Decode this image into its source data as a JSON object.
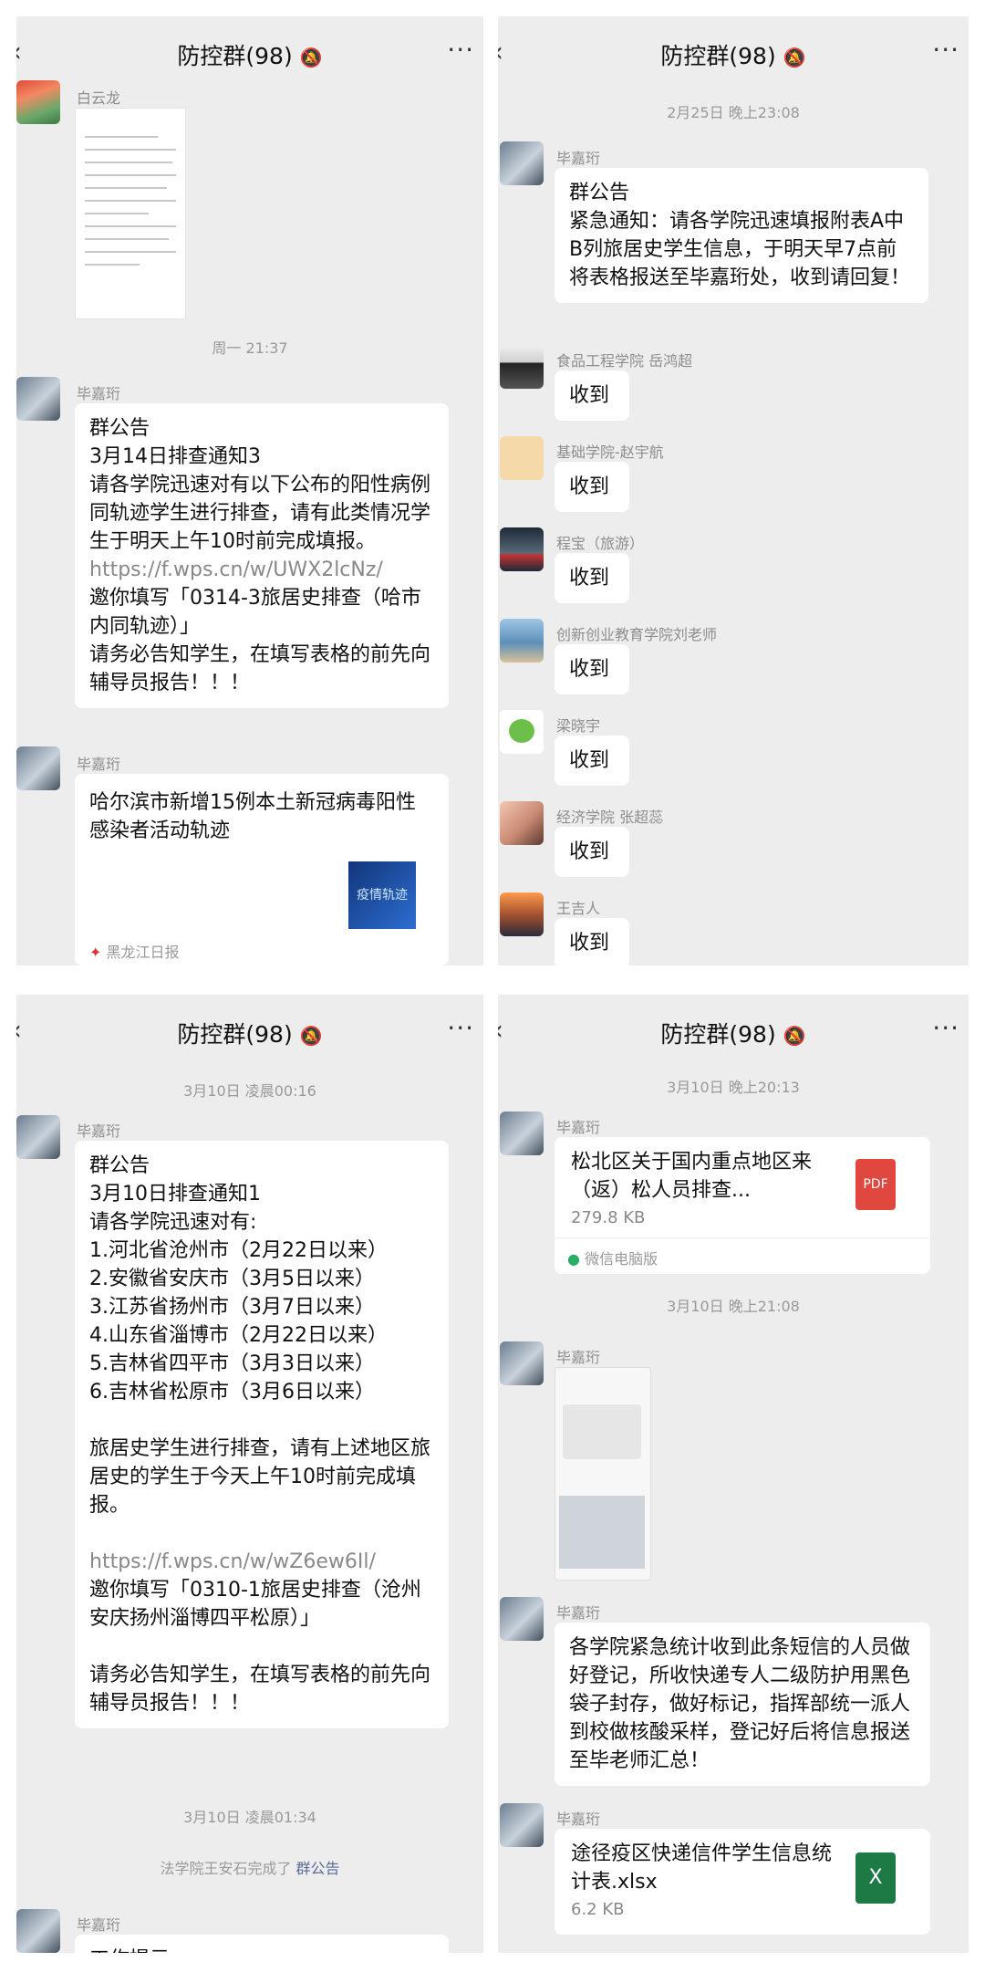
{
  "group_title": "防控群(98)",
  "panel1": {
    "sender1": "白云龙",
    "time1": "周一 21:37",
    "sender2": "毕嘉珩",
    "msg2": "群公告\n3月14日排查通知3\n请各学院迅速对有以下公布的阳性病例同轨迹学生进行排查，请有此类情况学生于明天上午10时前完成填报。",
    "link2": "https://f.wps.cn/w/UWX2lcNz/",
    "msg2b": "邀你填写「0314-3旅居史排查（哈市内同轨迹）」\n请务必告知学生，在填写表格的前先向辅导员报告！！！",
    "sender3": "毕嘉珩",
    "msg3": "哈尔滨市新增15例本土新冠病毒阳性感染者活动轨迹",
    "thumb3": "疫情轨迹",
    "source3": "黑龙江日报"
  },
  "panel2": {
    "time1": "2月25日 晚上23:08",
    "sender1": "毕嘉珩",
    "msg1": "群公告\n紧急通知：请各学院迅速填报附表A中B列旅居史学生信息，于明天早7点前将表格报送至毕嘉珩处，收到请回复！",
    "replies": [
      {
        "sender": "食品工程学院 岳鸿超",
        "text": "收到"
      },
      {
        "sender": "基础学院-赵宇航",
        "text": "收到"
      },
      {
        "sender": "程宝（旅游）",
        "text": "收到"
      },
      {
        "sender": "创新创业教育学院刘老师",
        "text": "收到"
      },
      {
        "sender": "梁晓宇",
        "text": "收到"
      },
      {
        "sender": "经济学院 张超蕊",
        "text": "收到"
      },
      {
        "sender": "王吉人",
        "text": "收到"
      }
    ]
  },
  "panel3": {
    "time1": "3月10日 凌晨00:16",
    "sender1": "毕嘉珩",
    "msg1": "群公告\n3月10日排查通知1\n请各学院迅速对有:\n1.河北省沧州市（2月22日以来）\n2.安徽省安庆市（3月5日以来）\n3.江苏省扬州市（3月7日以来）\n4.山东省淄博市（2月22日以来）\n5.吉林省四平市（3月3日以来）\n6.吉林省松原市（3月6日以来）\n\n旅居史学生进行排查，请有上述地区旅居史的学生于今天上午10时前完成填报。\n\n",
    "link1": "https://f.wps.cn/w/wZ6ew6Il/",
    "msg1b": "邀你填写「0310-1旅居史排查（沧州安庆扬州淄博四平松原）」\n\n请务必告知学生，在填写表格的前先向辅导员报告！！！",
    "time2": "3月10日 凌晨01:34",
    "notice_prefix": "法学院王安石完成了",
    "notice_link": "群公告",
    "sender2": "毕嘉珩",
    "msg2": "工作提示"
  },
  "panel4": {
    "time1": "3月10日 晚上20:13",
    "sender1": "毕嘉珩",
    "file1_name": "松北区关于国内重点地区来（返）松人员排查...",
    "file1_size": "279.8 KB",
    "file1_icon": "PDF",
    "file1_source": "微信电脑版",
    "time2": "3月10日 晚上21:08",
    "sender2": "毕嘉珩",
    "sender3": "毕嘉珩",
    "msg3": "各学院紧急统计收到此条短信的人员做好登记，所收快递专人二级防护用黑色袋子封存，做好标记，指挥部统一派人到校做核酸采样，登记好后将信息报送至毕老师汇总！",
    "sender4": "毕嘉珩",
    "file2_name": "途径疫区快递信件学生信息统计表.xlsx",
    "file2_size": "6.2 KB",
    "file2_icon": "X"
  }
}
